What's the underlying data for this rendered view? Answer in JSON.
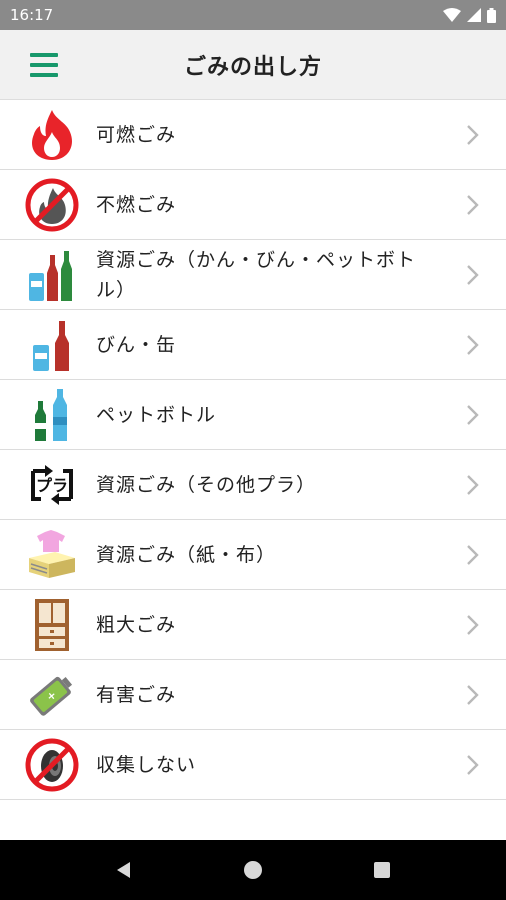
{
  "status": {
    "time": "16:17"
  },
  "appbar": {
    "title": "ごみの出し方"
  },
  "colors": {
    "accent": "#17986b",
    "status_bar": "#8a8a8a",
    "nav_bar": "#000000"
  },
  "items": [
    {
      "label": "可燃ごみ",
      "icon": "fire-icon"
    },
    {
      "label": "不燃ごみ",
      "icon": "no-fire-icon"
    },
    {
      "label": "資源ごみ（かん・びん・ペットボトル）",
      "icon": "bottles-cans-icon"
    },
    {
      "label": "びん・缶",
      "icon": "bottle-can-icon"
    },
    {
      "label": "ペットボトル",
      "icon": "pet-bottle-icon"
    },
    {
      "label": "資源ごみ（その他プラ）",
      "icon": "plastic-recycle-icon"
    },
    {
      "label": "資源ごみ（紙・布）",
      "icon": "paper-cloth-icon"
    },
    {
      "label": "粗大ごみ",
      "icon": "cabinet-icon"
    },
    {
      "label": "有害ごみ",
      "icon": "battery-icon"
    },
    {
      "label": "収集しない",
      "icon": "no-tire-icon"
    }
  ]
}
